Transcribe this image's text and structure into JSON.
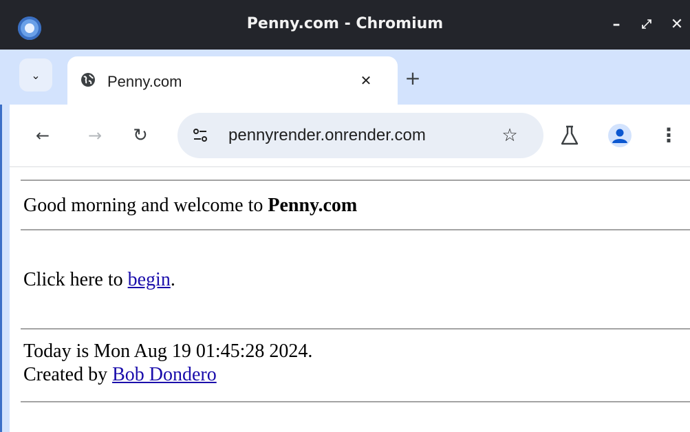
{
  "window": {
    "title": "Penny.com - Chromium",
    "controls": {
      "minimize": "–",
      "maximize": "⤢",
      "close": "✕"
    }
  },
  "tabs": [
    {
      "title": "Penny.com",
      "icon": "globe-icon",
      "active": true
    }
  ],
  "toolbar": {
    "url": "pennyrender.onrender.com"
  },
  "page": {
    "greeting_prefix": "Good morning and welcome to",
    "greeting_site": "Penny.com",
    "click_prefix": "Click here to",
    "click_link": "begin",
    "click_suffix": ".",
    "date_text": "Today is Mon Aug 19 01:45:28 2024.",
    "created_prefix": "Created by",
    "created_link": "Bob Dondero"
  },
  "colors": {
    "titlebar": "#23252b",
    "tabstrip": "#d3e3fd",
    "link": "#1a0dab"
  }
}
